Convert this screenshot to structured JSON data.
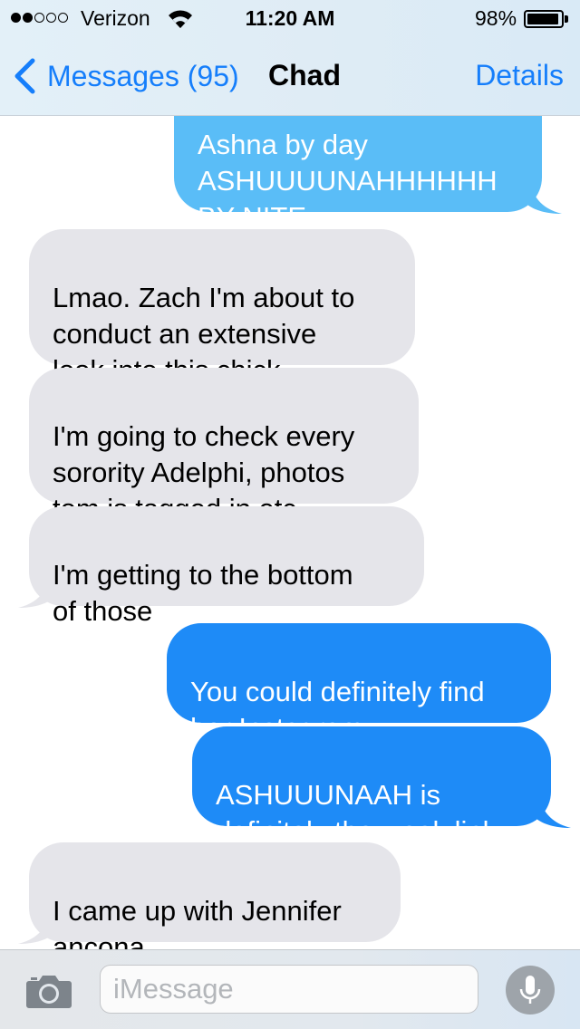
{
  "status_bar": {
    "carrier": "Verizon",
    "time": "11:20 AM",
    "battery": "98%",
    "signal_bars_filled": 2,
    "signal_bars_total": 5,
    "battery_level": 0.98
  },
  "nav": {
    "back_label": "Messages (95)",
    "title": "Chad",
    "details_label": "Details"
  },
  "messages": [
    {
      "direction": "outgoing",
      "text": "Ashna by day\nASHUUUUNAHHHHHH\nBY NITE"
    },
    {
      "direction": "incoming",
      "text": "Lmao. Zach I'm about to\nconduct an extensive\nlook into this chick"
    },
    {
      "direction": "incoming",
      "text": "I'm going to check every\nsorority Adelphi, photos\ntom is tagged in etc"
    },
    {
      "direction": "incoming",
      "text": "I'm getting to the bottom\nof those"
    },
    {
      "direction": "outgoing",
      "text": "You could definitely find\nher Instagram"
    },
    {
      "direction": "outgoing",
      "text": "ASHUUUNAAH is\ndefinitely the weak link"
    },
    {
      "direction": "incoming",
      "text": "I came up with Jennifer\nancona"
    }
  ],
  "input": {
    "placeholder": "iMessage"
  },
  "colors": {
    "outgoing_bubble": "#1e8bf7",
    "outgoing_bubble_top": "#5abdf7",
    "incoming_bubble": "#e5e5ea",
    "tint": "#157efb"
  },
  "icons": [
    "back-chevron-icon",
    "wifi-icon",
    "battery-icon",
    "camera-icon",
    "microphone-icon"
  ]
}
